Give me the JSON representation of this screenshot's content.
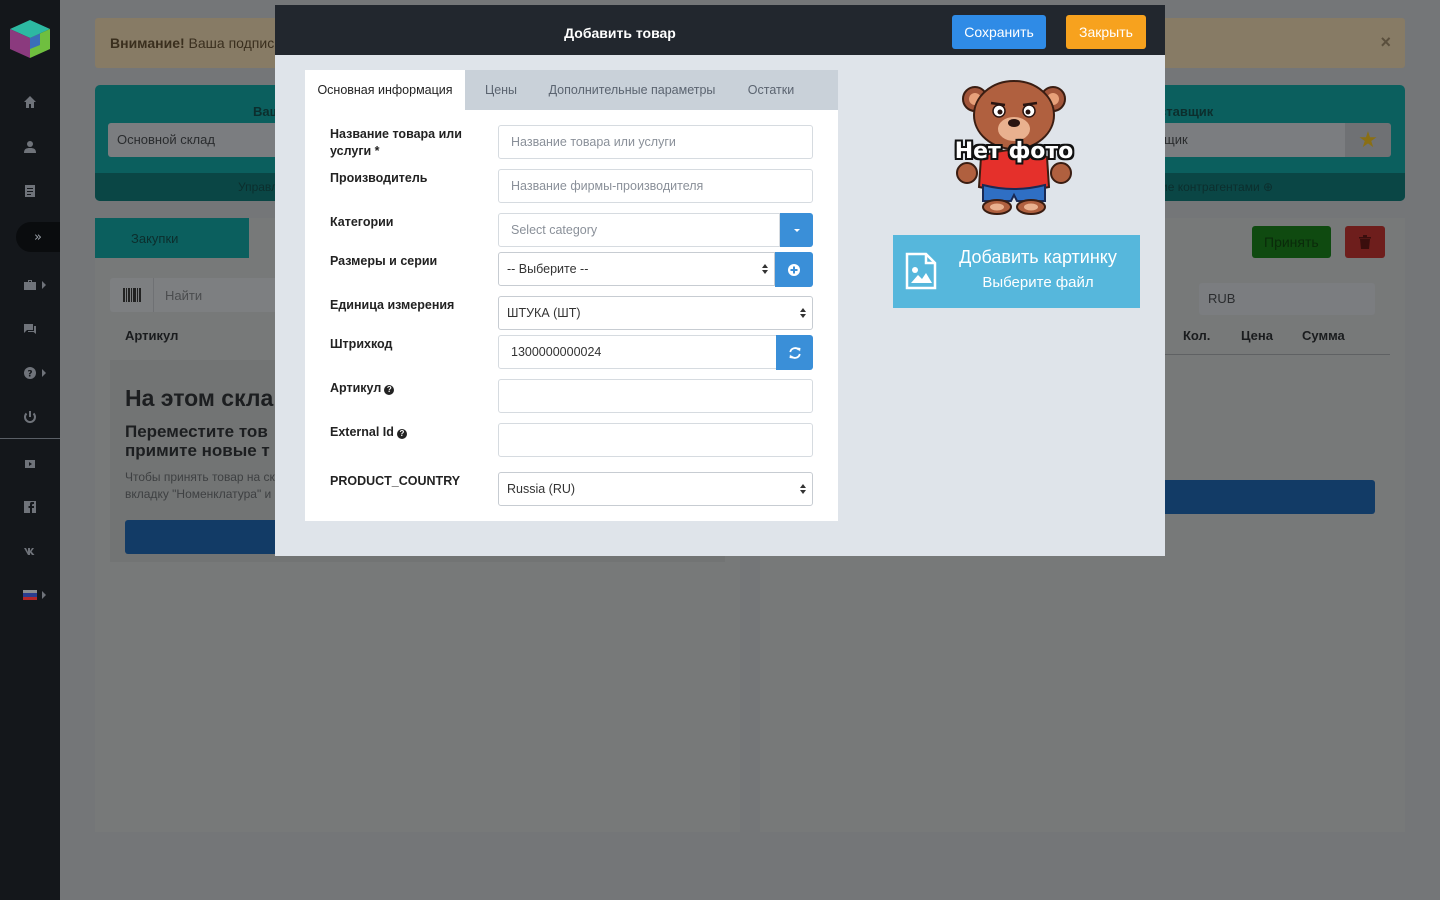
{
  "sidebar": {
    "toggle_glyph": "»",
    "items": [
      {
        "icon": "home-icon"
      },
      {
        "icon": "user-icon"
      },
      {
        "icon": "document-icon"
      },
      {
        "icon": "briefcase-icon",
        "has_submenu": true
      },
      {
        "icon": "chat-icon"
      },
      {
        "icon": "help-icon",
        "has_submenu": true
      },
      {
        "icon": "power-icon"
      },
      {
        "icon": "youtube-icon"
      },
      {
        "icon": "facebook-icon"
      },
      {
        "icon": "vk-icon"
      },
      {
        "icon": "russian-flag-icon",
        "has_submenu": true
      }
    ]
  },
  "background": {
    "alert_strong": "Внимание!",
    "alert_text": " Ваша подпис",
    "alert_close": "×",
    "warehouse_label": "Ваш",
    "warehouse_value": "Основной склад",
    "supplier_label": "ставщик",
    "supplier_value": "щик",
    "manage_left": "Управл",
    "manage_right": "ие контрагентами ⊕",
    "purchases_tab": "Закупки",
    "search_placeholder": "Найти",
    "col_artikul": "Артикул",
    "empty_h1": "На этом скла",
    "empty_h2": "Переместите тов примите новые т",
    "empty_p": "Чтобы принять товар на ск вкладку \"Номенклатура\" и",
    "accept_label": "Принять",
    "currency": "RUB",
    "col_qty": "Кол.",
    "col_price": "Цена",
    "col_sum": "Сумма"
  },
  "modal": {
    "title": "Добавить товар",
    "save_label": "Сохранить",
    "close_label": "Закрыть",
    "tabs": [
      {
        "label": "Основная информация",
        "active": true
      },
      {
        "label": "Цены",
        "active": false
      },
      {
        "label": "Дополнительные параметры",
        "active": false
      },
      {
        "label": "Остатки",
        "active": false
      }
    ],
    "fields": {
      "name": {
        "label": "Название товара или услуги *",
        "placeholder": "Название товара или услуги"
      },
      "manufacturer": {
        "label": "Производитель",
        "placeholder": "Название фирмы-производителя"
      },
      "categories": {
        "label": "Категории",
        "placeholder": "Select category"
      },
      "sizes": {
        "label": "Размеры и серии",
        "value": "-- Выберите --"
      },
      "unit": {
        "label": "Единица измерения",
        "value": "ШТУКА (ШТ)"
      },
      "barcode": {
        "label": "Штрихкод",
        "value": "1300000000024"
      },
      "artikul": {
        "label": "Артикул",
        "value": ""
      },
      "external_id": {
        "label": "External Id",
        "value": ""
      },
      "country": {
        "label": "PRODUCT_COUNTRY",
        "value": "Russia (RU)"
      }
    },
    "photo": {
      "no_photo_text": "Нет фото",
      "add_image_title": "Добавить картинку",
      "add_image_subtitle": "Выберите файл"
    }
  },
  "colors": {
    "modal_header": "#22272e",
    "save_button": "#2f8be6",
    "close_button": "#f7a21e",
    "addon_blue": "#3a8fd8",
    "add_image": "#56b7dc"
  }
}
